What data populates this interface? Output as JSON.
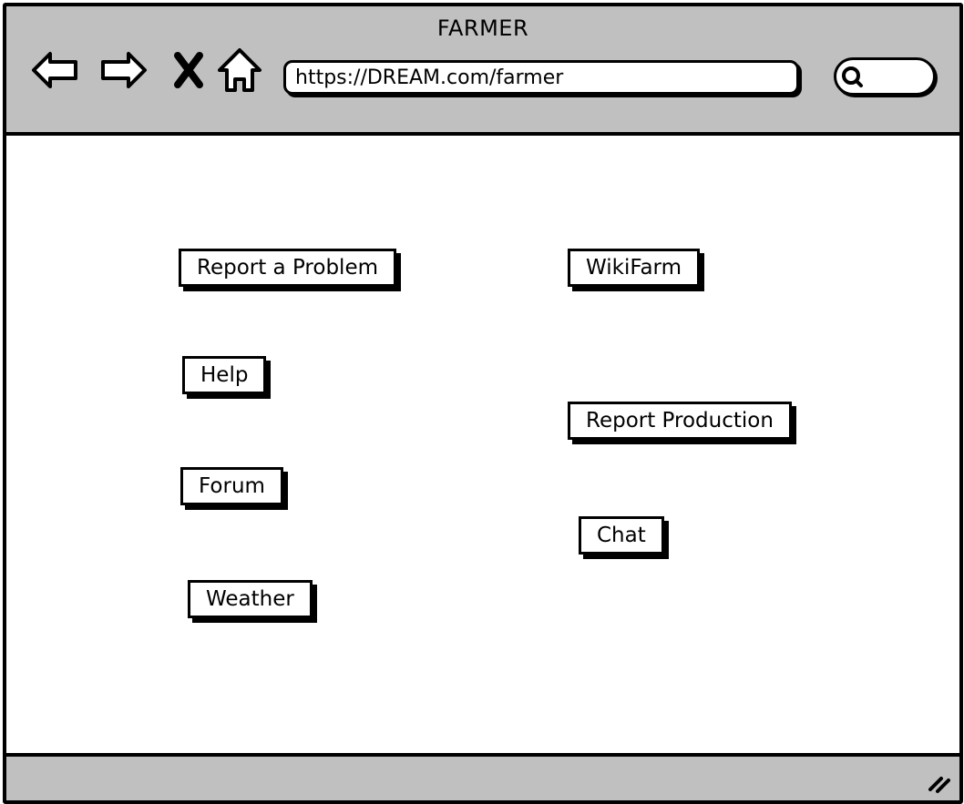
{
  "window": {
    "title": "FARMER"
  },
  "toolbar": {
    "back_icon": "back-arrow-icon",
    "forward_icon": "forward-arrow-icon",
    "stop_icon": "close-icon",
    "home_icon": "home-icon",
    "address": "https://DREAM.com/farmer",
    "search_icon": "search-icon"
  },
  "main": {
    "buttons": {
      "report_problem": "Report a Problem",
      "wikifarm": "WikiFarm",
      "help": "Help",
      "report_production": "Report Production",
      "forum": "Forum",
      "chat": "Chat",
      "weather": "Weather"
    }
  },
  "statusbar": {
    "resize_icon": "resize-grip-icon"
  }
}
